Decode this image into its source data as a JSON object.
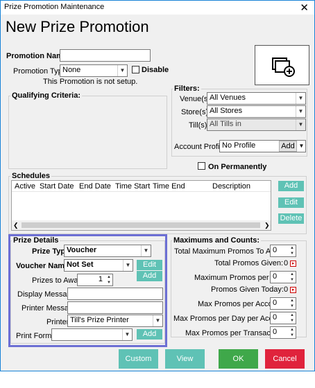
{
  "window": {
    "title": "Prize Promotion Maintenance",
    "close_glyph": "✕"
  },
  "page": {
    "heading": "New Prize Promotion"
  },
  "promotion": {
    "name_label": "Promotion Name:",
    "name_value": "",
    "type_label": "Promotion Type:",
    "type_value": "None",
    "disable_label": "Disable",
    "setup_note": "This Promotion is not setup."
  },
  "qualifying": {
    "label": "Qualifying Criteria:"
  },
  "filters": {
    "label": "Filters:",
    "venue_label": "Venue(s):",
    "venue_value": "All Venues",
    "store_label": "Store(s):",
    "store_value": "All Stores",
    "till_label": "Till(s):",
    "till_value": "All Tills in",
    "account_profile_label": "Account Profile:",
    "account_profile_value": "No Profile",
    "add_label": "Add"
  },
  "on_permanently_label": "On Permanently",
  "schedules": {
    "label": "Schedules",
    "columns": [
      "Active",
      "Start Date",
      "End Date",
      "Time Start",
      "Time End",
      "Description"
    ],
    "add_label": "Add",
    "edit_label": "Edit",
    "delete_label": "Delete"
  },
  "prize": {
    "label": "Prize Details",
    "type_label": "Prize Type:",
    "type_value": "Voucher",
    "voucher_label": "Voucher Name:",
    "voucher_value": "Not Set",
    "edit_label": "Edit",
    "add_label": "Add",
    "prizes_award_label": "Prizes to Award:",
    "prizes_award_value": "1",
    "display_msg_label": "Display Message:",
    "display_msg_value": "",
    "printer_msg_label": "Printer Message:",
    "printer_msg_value": "",
    "printer_label": "Printer:",
    "printer_value": "Till's Prize Printer",
    "print_format_label": "Print Format:",
    "print_format_value": "",
    "print_add_label": "Add"
  },
  "maximums": {
    "label": "Maximums and Counts:",
    "total_max_label": "Total Maximum Promos To Award:",
    "total_max_value": "0",
    "total_given_label": "Total Promos Given:",
    "total_given_value": "0",
    "max_day_label": "Maximum Promos per Day:",
    "max_day_value": "0",
    "given_today_label": "Promos Given Today:",
    "given_today_value": "0",
    "max_account_label": "Max Promos per Account:",
    "max_account_value": "0",
    "max_day_account_label": "Max Promos per Day per Account:",
    "max_day_account_value": "0",
    "max_transaction_label": "Max Promos per Transaction:",
    "max_transaction_value": "0"
  },
  "footer": {
    "custom_info_label": "Custom Info",
    "view_usage_label": "View Usage",
    "ok_label": "OK",
    "cancel_label": "Cancel"
  },
  "colors": {
    "teal": "#5fc2b5",
    "ok": "#3fa84a",
    "cancel": "#e0233c",
    "highlight": "#6c6fd4"
  }
}
